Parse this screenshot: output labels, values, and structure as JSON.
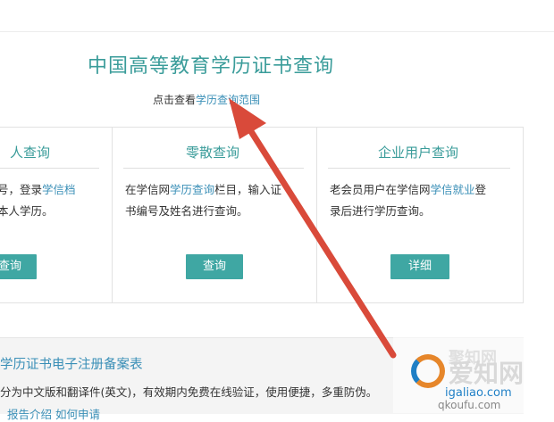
{
  "header": {
    "title": "中国高等教育学历证书查询",
    "sub_prefix": "点击查看",
    "sub_link": "学历查询范围"
  },
  "panels": [
    {
      "title": "人查询",
      "line1_a": "号，登录",
      "line1_link": "学信档",
      "line2": "本人学历。",
      "button": "查询"
    },
    {
      "title": "零散查询",
      "line1_a": "在学信网",
      "line1_link": "学历查询",
      "line1_b": "栏目，输入证",
      "line2": "书编号及姓名进行查询。",
      "button": "查询"
    },
    {
      "title": "企业用户查询",
      "line1_a": "老会员用户在学信网",
      "line1_link": "学信就业",
      "line1_b": "登",
      "line2": "录后进行学历查询。",
      "button": "详细"
    }
  ],
  "bottom": {
    "title": "学历证书电子注册备案表",
    "desc": "分为中文版和翻译件(英文)，有效期内免费在线验证，使用便捷，多重防伪。",
    "links": "报告介绍   如何申请"
  },
  "watermark": {
    "brand": "爱知网",
    "brand_small": "聚知网",
    "url": "igaliao.com",
    "url2": "qkoufu.com"
  },
  "colors": {
    "teal": "#3a9c9a",
    "link_blue": "#3a8fb7",
    "button_bg": "#3fa7a3",
    "arrow_red": "#d94a3a"
  }
}
